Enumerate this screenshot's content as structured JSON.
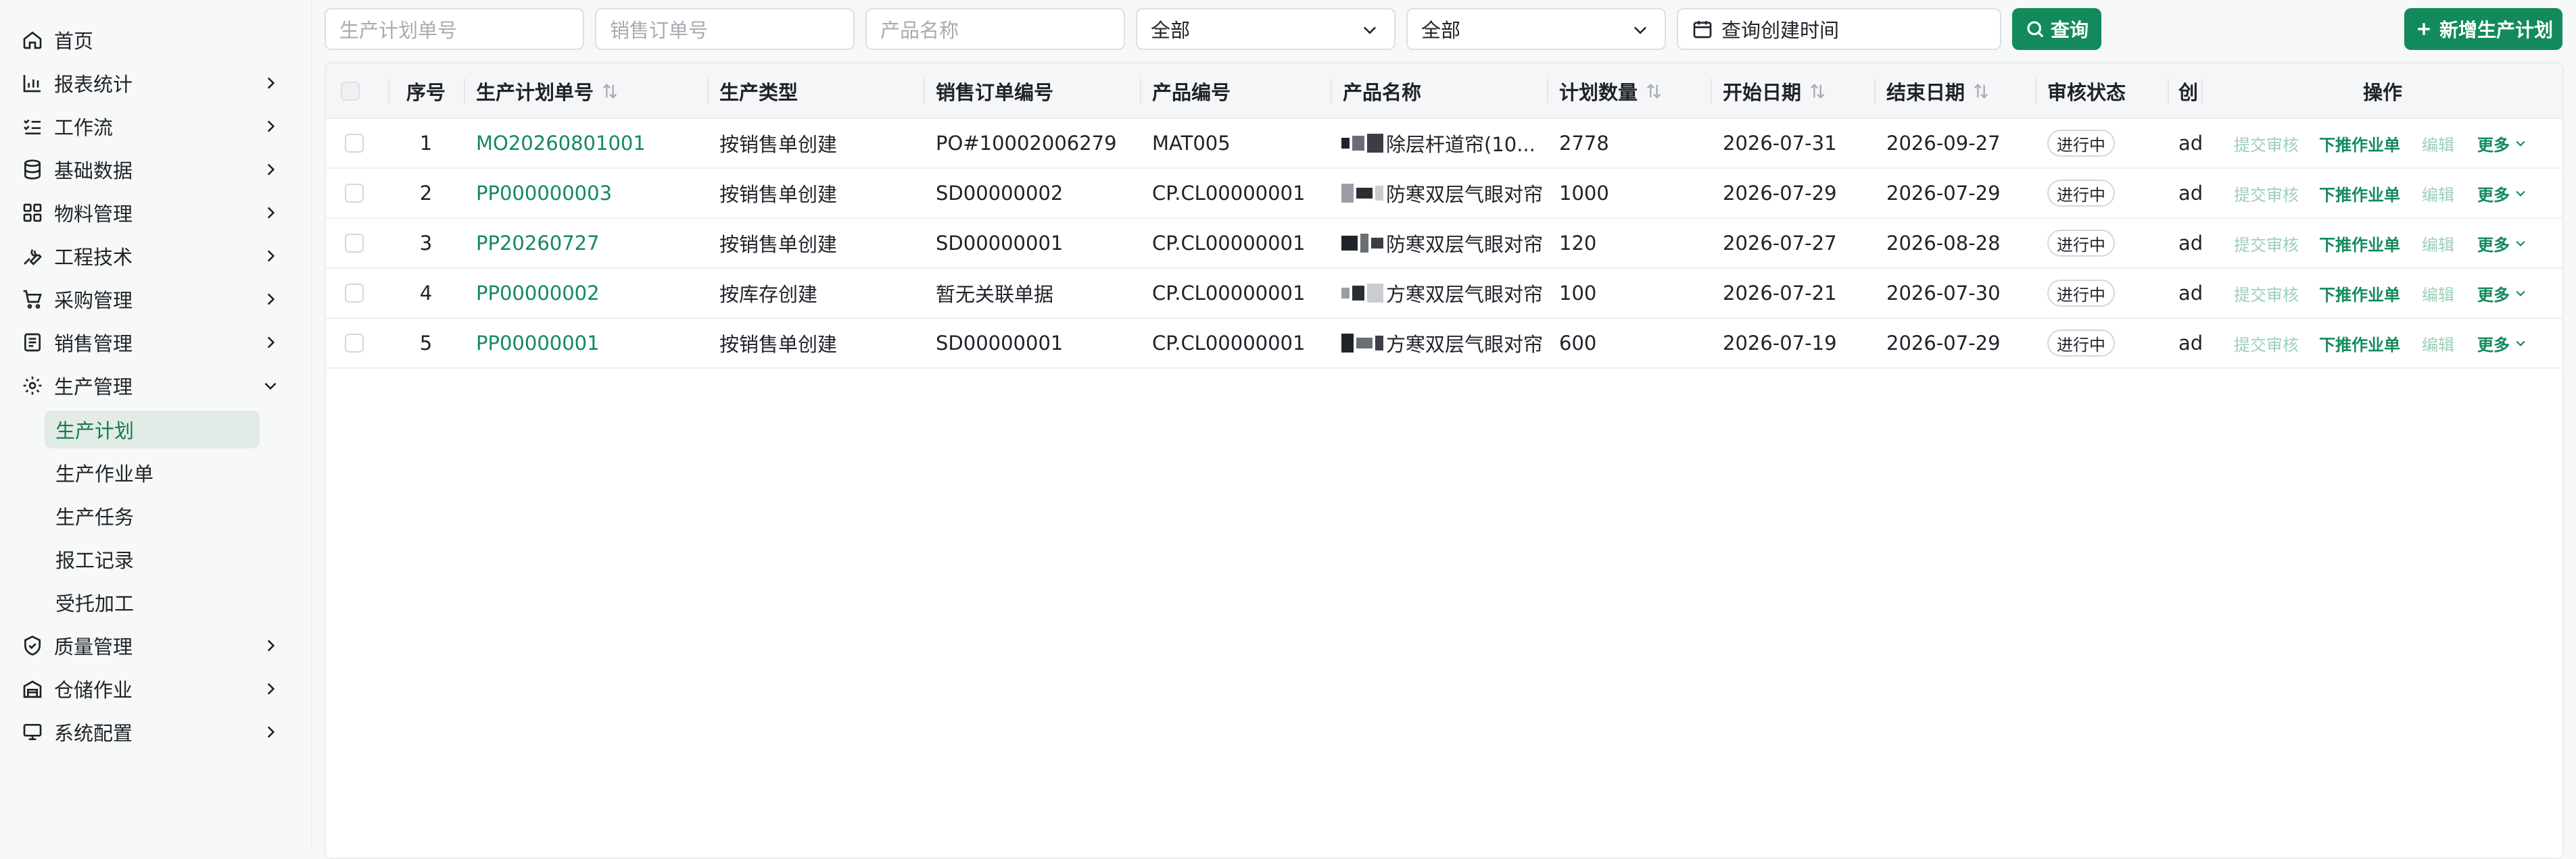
{
  "sidebar": {
    "items": [
      {
        "label": "首页",
        "icon": "home-icon",
        "has_arrow": false
      },
      {
        "label": "报表统计",
        "icon": "bar-chart-icon",
        "has_arrow": true
      },
      {
        "label": "工作流",
        "icon": "workflow-icon",
        "has_arrow": true
      },
      {
        "label": "基础数据",
        "icon": "database-icon",
        "has_arrow": true
      },
      {
        "label": "物料管理",
        "icon": "grid-icon",
        "has_arrow": true
      },
      {
        "label": "工程技术",
        "icon": "wrench-icon",
        "has_arrow": true
      },
      {
        "label": "采购管理",
        "icon": "cart-icon",
        "has_arrow": true
      },
      {
        "label": "销售管理",
        "icon": "receipt-icon",
        "has_arrow": true
      },
      {
        "label": "生产管理",
        "icon": "gear-icon",
        "has_arrow": true,
        "expanded": true
      },
      {
        "label": "质量管理",
        "icon": "shield-check-icon",
        "has_arrow": true
      },
      {
        "label": "仓储作业",
        "icon": "warehouse-icon",
        "has_arrow": true
      },
      {
        "label": "系统配置",
        "icon": "monitor-icon",
        "has_arrow": true
      }
    ],
    "production_sub": [
      {
        "label": "生产计划",
        "active": true
      },
      {
        "label": "生产作业单",
        "active": false
      },
      {
        "label": "生产任务",
        "active": false
      },
      {
        "label": "报工记录",
        "active": false
      },
      {
        "label": "受托加工",
        "active": false
      }
    ]
  },
  "toolbar": {
    "plan_no_placeholder": "生产计划单号",
    "sales_order_placeholder": "销售订单号",
    "product_name_placeholder": "产品名称",
    "select1_value": "全部",
    "select2_value": "全部",
    "date_placeholder": "查询创建时间",
    "search_label": "查询",
    "add_label": "新增生产计划"
  },
  "table": {
    "headers": {
      "index": "序号",
      "plan_no": "生产计划单号",
      "type": "生产类型",
      "sales_order": "销售订单编号",
      "product_code": "产品编号",
      "product_name": "产品名称",
      "qty": "计划数量",
      "start": "开始日期",
      "end": "结束日期",
      "status": "审核状态",
      "creator": "创",
      "ops": "操作"
    },
    "rows": [
      {
        "index": "1",
        "plan_no": "MO20260801001",
        "type": "按销售单创建",
        "sales_order": "PO#10002006279",
        "product_code": "MAT005",
        "product_name": "除层杆道帘(10...",
        "qty": "2778",
        "start": "2026-07-31",
        "end": "2026-09-27",
        "status": "进行中",
        "creator": "ad"
      },
      {
        "index": "2",
        "plan_no": "PP000000003",
        "type": "按销售单创建",
        "sales_order": "SD00000002",
        "product_code": "CP.CL00000001",
        "product_name": "防寒双层气眼对帘",
        "qty": "1000",
        "start": "2026-07-29",
        "end": "2026-07-29",
        "status": "进行中",
        "creator": "ad"
      },
      {
        "index": "3",
        "plan_no": "PP20260727",
        "type": "按销售单创建",
        "sales_order": "SD00000001",
        "product_code": "CP.CL00000001",
        "product_name": "防寒双层气眼对帘",
        "qty": "120",
        "start": "2026-07-27",
        "end": "2026-08-28",
        "status": "进行中",
        "creator": "ad"
      },
      {
        "index": "4",
        "plan_no": "PP00000002",
        "type": "按库存创建",
        "sales_order": "暂无关联单据",
        "product_code": "CP.CL00000001",
        "product_name": "方寒双层气眼对帘",
        "qty": "100",
        "start": "2026-07-21",
        "end": "2026-07-30",
        "status": "进行中",
        "creator": "ad"
      },
      {
        "index": "5",
        "plan_no": "PP00000001",
        "type": "按销售单创建",
        "sales_order": "SD00000001",
        "product_code": "CP.CL00000001",
        "product_name": "方寒双层气眼对帘",
        "qty": "600",
        "start": "2026-07-19",
        "end": "2026-07-29",
        "status": "进行中",
        "creator": "ad"
      }
    ],
    "actions": {
      "submit": "提交审核",
      "push": "下推作业单",
      "edit": "编辑",
      "more": "更多"
    }
  },
  "colors": {
    "accent": "#138a5c",
    "active_bg": "#e2ebe6",
    "muted_action": "#9ccfb8"
  }
}
